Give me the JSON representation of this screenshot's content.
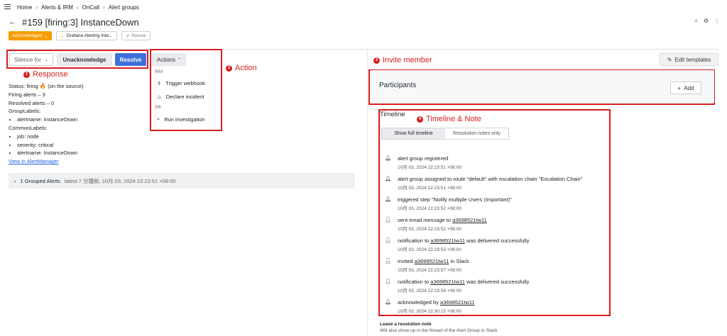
{
  "breadcrumb": [
    "Home",
    "Alerts & IRM",
    "OnCall",
    "Alert groups"
  ],
  "title": "#159 [firing:3] InstanceDown",
  "status_badge": "Acknowledged",
  "integration_chip": "Grafana Alerting Inte...",
  "source_chip": "Source",
  "toolbar": {
    "silence": "Silence for",
    "unack": "Unacknowledge",
    "resolve": "Resolve",
    "actions": "Actions"
  },
  "annotations": {
    "response": "Response",
    "action": "Action",
    "invite": "Invite member",
    "timeline": "Timeline & Note",
    "n1": "1",
    "n2": "2",
    "n3": "3",
    "n4": "4"
  },
  "actions_menu": {
    "group1": "IRM",
    "trigger": "Trigger webhook",
    "declare": "Declare incident",
    "group2": "Sift",
    "run": "Run investigation"
  },
  "info": {
    "status": "Status: firing 🔥 (on the source)",
    "firing": "Firing alerts – 3",
    "resolved": "Resolved alerts – 0",
    "group_labels": "GroupLabels:",
    "g1": "alertname: InstanceDown",
    "common_labels": "CommonLabels:",
    "c1": "job: node",
    "c2": "severity: critical",
    "c3": "alertname: InstanceDown",
    "link": "View in AlertManager"
  },
  "grouped": {
    "label": "1 Grouped Alerts",
    "latest": "latest 7 分鐘前, 10月 03, 2024 22:23:51 +08:00"
  },
  "edit_templates": "Edit templates",
  "participants": {
    "label": "Participants",
    "add": "Add"
  },
  "timeline": {
    "title": "Timeline",
    "tab_full": "Show full timeline",
    "tab_notes": "Resolution notes only",
    "events": [
      {
        "pre": "alert group registered",
        "link": "",
        "post": "",
        "time": "10月 03, 2024 22:23:51 +08:00"
      },
      {
        "pre": "alert group assigned to route \"default\" with escalation chain \"Escalation Chain\"",
        "link": "",
        "post": "",
        "time": "10月 03, 2024 22:23:51 +08:00"
      },
      {
        "pre": "triggered step \"Notify multiple Users (Important)\"",
        "link": "",
        "post": "",
        "time": "10月 03, 2024 22:23:52 +08:00"
      },
      {
        "pre": "sent email message to ",
        "link": "a3698521tw11",
        "post": "",
        "time": "10月 03, 2024 22:23:52 +08:00"
      },
      {
        "pre": "notification to ",
        "link": "a3698521tw11",
        "post": " was delivered successfully",
        "time": "10月 03, 2024 22:23:53 +08:00"
      },
      {
        "pre": "invited ",
        "link": "a3698521tw11",
        "post": " in Slack",
        "time": "10月 03, 2024 22:23:57 +08:00"
      },
      {
        "pre": "notification to ",
        "link": "a3698521tw11",
        "post": " was delivered successfully",
        "time": "10月 03, 2024 22:23:58 +08:00"
      },
      {
        "pre": "acknowledged by ",
        "link": "a3698521tw11",
        "post": "",
        "time": "10月 03, 2024 22:30:15 +08:00"
      }
    ]
  },
  "resolution_note": {
    "title": "Leave a resolution note",
    "sub": "Will also show up in the thread of the Alert Group in Slack"
  }
}
